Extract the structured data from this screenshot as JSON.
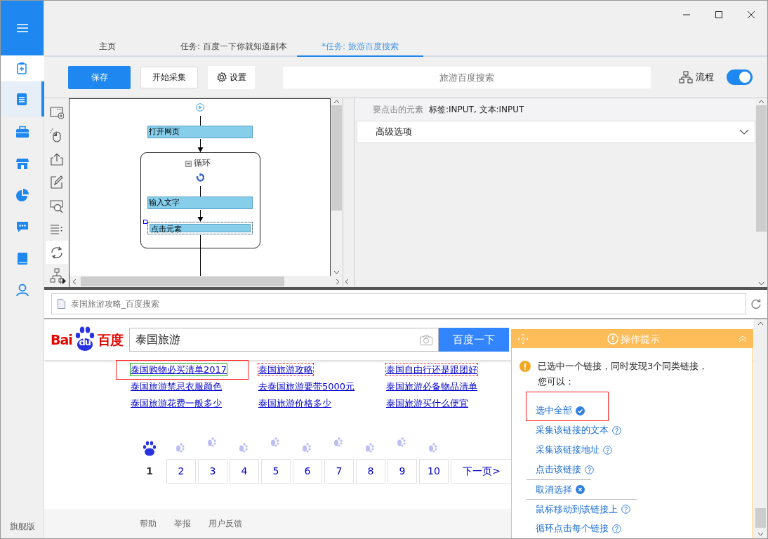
{
  "sidebar": {
    "items": [
      {
        "kind": "clipboard",
        "selected": false
      },
      {
        "kind": "document",
        "selected": true
      },
      {
        "kind": "toolbox",
        "selected": false
      },
      {
        "kind": "store",
        "selected": false
      },
      {
        "kind": "chart",
        "selected": false
      },
      {
        "kind": "chat",
        "selected": false
      },
      {
        "kind": "book",
        "selected": false
      },
      {
        "kind": "user",
        "selected": false
      }
    ],
    "edition": "旗舰版"
  },
  "tabs": [
    {
      "label": "主页",
      "selected": false
    },
    {
      "label": "任务: 百度一下你就知道副本",
      "selected": false
    },
    {
      "label": "*任务: 旅游百度搜索",
      "selected": true
    }
  ],
  "toolbar": {
    "save": "保存",
    "start": "开始采集",
    "settings": "设置",
    "task_name": "旅游百度搜索",
    "flow_label": "流程",
    "flow_on": true
  },
  "palette": [
    {
      "kind": "open-page",
      "selected": false
    },
    {
      "kind": "click",
      "selected": false
    },
    {
      "kind": "extract",
      "selected": false
    },
    {
      "kind": "input",
      "selected": false
    },
    {
      "kind": "captcha",
      "selected": false
    },
    {
      "kind": "select",
      "selected": false
    },
    {
      "kind": "loop",
      "selected": true
    },
    {
      "kind": "branch",
      "selected": false
    }
  ],
  "flow": {
    "steps": [
      {
        "kind": "step",
        "label": "打开网页",
        "selected": false
      },
      {
        "kind": "loop",
        "label": "循环",
        "expanded": true,
        "children": [
          {
            "kind": "step",
            "label": "输入文字",
            "selected": false
          },
          {
            "kind": "step",
            "label": "点击元素",
            "selected": true
          }
        ]
      }
    ]
  },
  "properties": {
    "element_label": "要点击的元素",
    "element_value": "标签:INPUT, 文本:INPUT",
    "advanced": "高级选项",
    "advanced_expanded": false
  },
  "browser": {
    "address": "泰国旅游攻略_百度搜索",
    "logo": {
      "left": "Bai",
      "mark": "du",
      "right": "百度"
    },
    "query": "泰国旅游",
    "search_button": "百度一下",
    "related": [
      {
        "text": "泰国购物必买清单2017",
        "selected": true,
        "similar": false
      },
      {
        "text": "泰国旅游攻略",
        "selected": false,
        "similar": true
      },
      {
        "text": "泰国自由行还是跟团好",
        "selected": false,
        "similar": true
      },
      {
        "text": "泰国旅游禁忌衣服颜色",
        "selected": false,
        "similar": false
      },
      {
        "text": "去泰国旅游要带5000元",
        "selected": false,
        "similar": false
      },
      {
        "text": "泰国旅游必备物品清单",
        "selected": false,
        "similar": false
      },
      {
        "text": "泰国旅游花费一般多少",
        "selected": false,
        "similar": false
      },
      {
        "text": "泰国旅游价格多少",
        "selected": false,
        "similar": false
      },
      {
        "text": "泰国旅游买什么便宜",
        "selected": false,
        "similar": false
      }
    ],
    "pages": [
      {
        "label": "1",
        "selected": true
      },
      {
        "label": "2",
        "selected": false
      },
      {
        "label": "3",
        "selected": false
      },
      {
        "label": "4",
        "selected": false
      },
      {
        "label": "5",
        "selected": false
      },
      {
        "label": "6",
        "selected": false
      },
      {
        "label": "7",
        "selected": false
      },
      {
        "label": "8",
        "selected": false
      },
      {
        "label": "9",
        "selected": false
      },
      {
        "label": "10",
        "selected": false
      }
    ],
    "next": "下一页>",
    "footer": [
      "帮助",
      "举报",
      "用户反馈"
    ]
  },
  "tips": {
    "title": "操作提示",
    "message": "已选中一个链接，同时发现3个同类链接，您可以：",
    "actions": [
      {
        "label": "选中全部",
        "kind": "check",
        "highlighted": true,
        "divider": false
      },
      {
        "label": "采集该链接的文本",
        "kind": "help",
        "highlighted": false,
        "divider": false
      },
      {
        "label": "采集该链接地址",
        "kind": "help",
        "highlighted": false,
        "divider": false
      },
      {
        "label": "点击该链接",
        "kind": "help",
        "highlighted": false,
        "divider": false
      },
      {
        "label": "取消选择",
        "kind": "cancel",
        "highlighted": false,
        "divider": true
      },
      {
        "label": "鼠标移动到该链接上",
        "kind": "help",
        "highlighted": false,
        "divider": true
      },
      {
        "label": "循环点击每个链接",
        "kind": "help",
        "highlighted": false,
        "divider": false
      }
    ]
  }
}
